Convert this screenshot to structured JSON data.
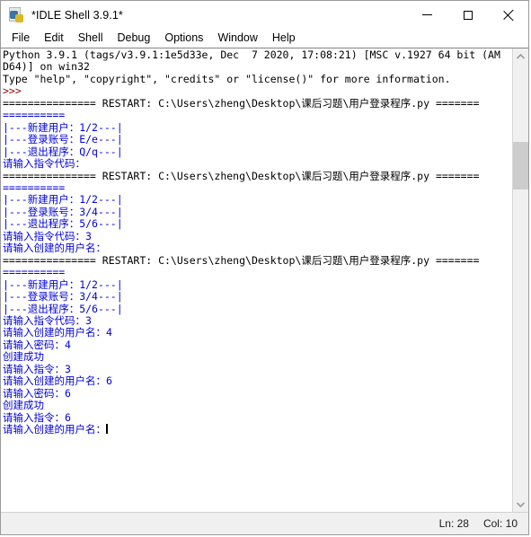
{
  "window": {
    "title": "*IDLE Shell 3.9.1*",
    "icon": "python-idle-icon",
    "controls": {
      "minimize": "minimize-button",
      "maximize": "maximize-button",
      "close": "close-button"
    }
  },
  "menubar": {
    "items": [
      {
        "label": "File"
      },
      {
        "label": "Edit"
      },
      {
        "label": "Shell"
      },
      {
        "label": "Debug"
      },
      {
        "label": "Options"
      },
      {
        "label": "Window"
      },
      {
        "label": "Help"
      }
    ]
  },
  "colors": {
    "text": "#000000",
    "stdout_blue": "#0000dd",
    "prompt_maroon": "#990000",
    "background": "#ffffff",
    "chrome": "#f0f0f0"
  },
  "shell": {
    "lines": [
      {
        "color": "black",
        "text": "Python 3.9.1 (tags/v3.9.1:1e5d33e, Dec  7 2020, 17:08:21) [MSC v.1927 64 bit (AM"
      },
      {
        "color": "black",
        "text": "D64)] on win32"
      },
      {
        "color": "black",
        "text": "Type \"help\", \"copyright\", \"credits\" or \"license()\" for more information."
      },
      {
        "color": "maroon",
        "text": ">>>"
      },
      {
        "color": "black",
        "text": "=============== RESTART: C:\\Users\\zheng\\Desktop\\课后习题\\用户登录程序.py ======="
      },
      {
        "color": "blue",
        "text": "=========="
      },
      {
        "color": "blue",
        "text": "|---新建用户：1/2---|"
      },
      {
        "color": "blue",
        "text": "|---登录账号：E/e---|"
      },
      {
        "color": "blue",
        "text": "|---退出程序：Q/q---|"
      },
      {
        "color": "blue",
        "text": "请输入指令代码："
      },
      {
        "color": "black",
        "text": "=============== RESTART: C:\\Users\\zheng\\Desktop\\课后习题\\用户登录程序.py ======="
      },
      {
        "color": "blue",
        "text": "=========="
      },
      {
        "color": "blue",
        "text": "|---新建用户：1/2---|"
      },
      {
        "color": "blue",
        "text": "|---登录账号：3/4---|"
      },
      {
        "color": "blue",
        "text": "|---退出程序：5/6---|"
      },
      {
        "color": "blue",
        "text": "请输入指令代码：3"
      },
      {
        "color": "blue",
        "text": "请输入创建的用户名："
      },
      {
        "color": "black",
        "text": "=============== RESTART: C:\\Users\\zheng\\Desktop\\课后习题\\用户登录程序.py ======="
      },
      {
        "color": "blue",
        "text": "=========="
      },
      {
        "color": "blue",
        "text": "|---新建用户：1/2---|"
      },
      {
        "color": "blue",
        "text": "|---登录账号：3/4---|"
      },
      {
        "color": "blue",
        "text": "|---退出程序：5/6---|"
      },
      {
        "color": "blue",
        "text": "请输入指令代码：3"
      },
      {
        "color": "blue",
        "text": "请输入创建的用户名：4"
      },
      {
        "color": "blue",
        "text": "请输入密码：4"
      },
      {
        "color": "blue",
        "text": "创建成功"
      },
      {
        "color": "blue",
        "text": "请输入指令：3"
      },
      {
        "color": "blue",
        "text": "请输入创建的用户名：6"
      },
      {
        "color": "blue",
        "text": "请输入密码：6"
      },
      {
        "color": "blue",
        "text": "创建成功"
      },
      {
        "color": "blue",
        "text": "请输入指令：6"
      },
      {
        "color": "blue",
        "text": "请输入创建的用户名：",
        "caret": true
      }
    ]
  },
  "scrollbar": {
    "up_arrow": "scroll-up-arrow",
    "down_arrow": "scroll-down-arrow",
    "thumb_top_pct": 18,
    "thumb_height_pct": 11
  },
  "statusbar": {
    "line": "Ln: 28",
    "col": "Col: 10"
  }
}
